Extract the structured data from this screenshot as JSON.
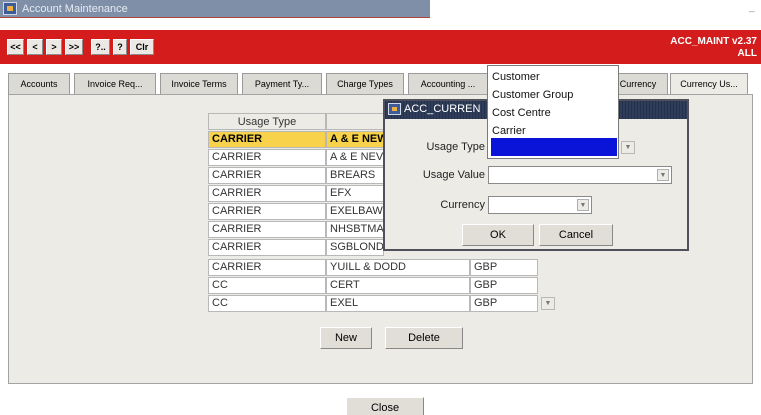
{
  "window": {
    "title": "Account Maintenance"
  },
  "toolbar": {
    "buttons": [
      "<<",
      "<",
      ">",
      ">>",
      "?..",
      "?",
      "Clr"
    ],
    "app_id": "ACC_MAINT v2.37",
    "app_scope": "ALL"
  },
  "tabs": [
    "Accounts",
    "Invoice Req...",
    "Invoice Terms",
    "Payment Ty...",
    "Charge Types",
    "Accounting ...",
    "Currency",
    "Currency Us..."
  ],
  "grid": {
    "header_usage_type": "Usage Type",
    "rows": [
      [
        "CARRIER",
        "A & E NEW",
        ""
      ],
      [
        "CARRIER",
        "A & E NEV",
        ""
      ],
      [
        "CARRIER",
        "BREARS",
        ""
      ],
      [
        "CARRIER",
        "EFX",
        ""
      ],
      [
        "CARRIER",
        "EXELBAW",
        ""
      ],
      [
        "CARRIER",
        "NHSBTMA",
        ""
      ],
      [
        "CARRIER",
        "SGBLOND",
        ""
      ],
      [
        "CARRIER",
        "YUILL & DODD",
        "GBP"
      ],
      [
        "CC",
        "CERT",
        "GBP"
      ],
      [
        "CC",
        "EXEL",
        "GBP"
      ]
    ]
  },
  "buttons": {
    "new": "New",
    "delete": "Delete",
    "close": "Close"
  },
  "dialog": {
    "title": "ACC_CURREN",
    "usage_type_label": "Usage Type",
    "usage_value_label": "Usage Value",
    "currency_label": "Currency",
    "ok": "OK",
    "cancel": "Cancel"
  },
  "dropdown": {
    "options": [
      "Customer",
      "Customer Group",
      "Cost Centre",
      "Carrier"
    ]
  },
  "colors": {
    "toolbar": "#d41c1c",
    "selected_row": "#f7d24a",
    "dialog_title": "#23314d",
    "highlight": "#0a14d8"
  }
}
